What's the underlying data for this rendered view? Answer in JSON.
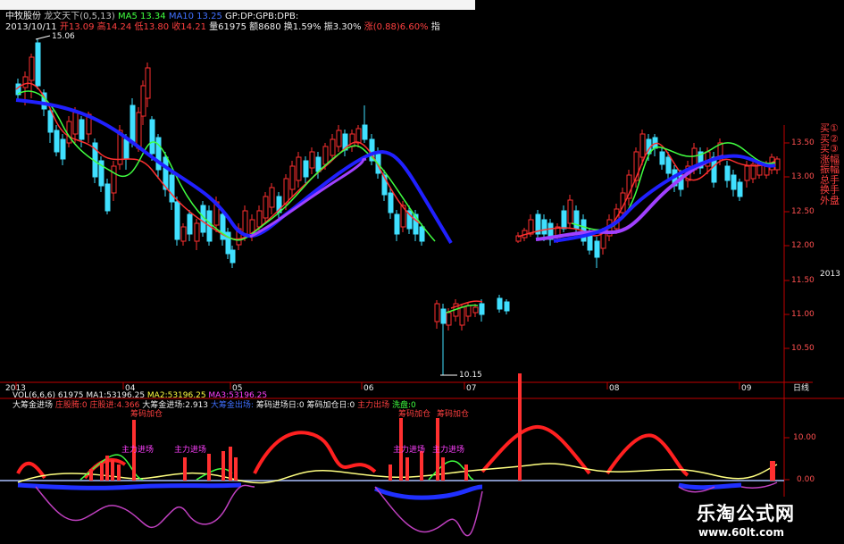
{
  "header": {
    "stock_name": "中牧股份",
    "indicator_name": "龙文天下",
    "indicator_params": "(0,5,13)",
    "ma5": "MA5 13.34",
    "ma10": "MA10 13.25",
    "tail": "GP:DP:GPB:DPB:",
    "date": "2013/10/11",
    "open": "开13.09",
    "high": "高14.24",
    "low": "低13.80",
    "close": "收14.21",
    "volume": "量61975",
    "amount": "额8680",
    "turnover": "换1.59%",
    "amplitude": "振3.30%",
    "ratio": "涨(0.88)6.60%",
    "cut": "指"
  },
  "main_chart": {
    "high_label": "15.06",
    "low_label": "10.15",
    "price_ticks": [
      "13.50",
      "13.00",
      "12.50",
      "12.00",
      "11.50",
      "11.00",
      "10.50"
    ],
    "price_axis_top": "2013",
    "x_labels": [
      "2013",
      "04",
      "05",
      "06",
      "07",
      "08",
      "09"
    ],
    "period_button": "日线"
  },
  "right_panel": [
    "买①",
    "买②",
    "买③",
    "涨幅",
    "振幅",
    "总手",
    "换手",
    "外盘"
  ],
  "vol_header": {
    "vol": "VOL(6,6,6)",
    "v": "61975",
    "ma1": "MA1:53196.25",
    "ma2": "MA2:53196.25",
    "ma3": "MA3:53196.25"
  },
  "indicator_header": {
    "name": "大筹金进场",
    "f1": "庄股腾:0",
    "f2": "庄股进:4.366",
    "f3": "大筹金进场:2.913",
    "f4": "大筹金出场:",
    "f5": "筹码进场日:0",
    "f6": "筹码加仓日:0",
    "f7": "主力出场",
    "f8": "洗盘:0"
  },
  "indicator_ticks": [
    "10.00",
    "0.00"
  ],
  "annotations": {
    "a1": "筹码加仓",
    "a2": "主力进场",
    "a3": "主力进场",
    "a4": "筹码加仓",
    "a5": "筹码加仓",
    "a6": "主力进场",
    "a7": "主力进场"
  },
  "watermark": {
    "title": "乐淘公式网",
    "url": "www.60lt.com"
  },
  "colors": {
    "up": "#ff3030",
    "down": "#40e0ff",
    "ma_red": "#ff3030",
    "ma_green": "#40ff40",
    "ma_blue": "#2020ff",
    "ma_purple": "#a040ff",
    "axis": "#c00000"
  }
}
